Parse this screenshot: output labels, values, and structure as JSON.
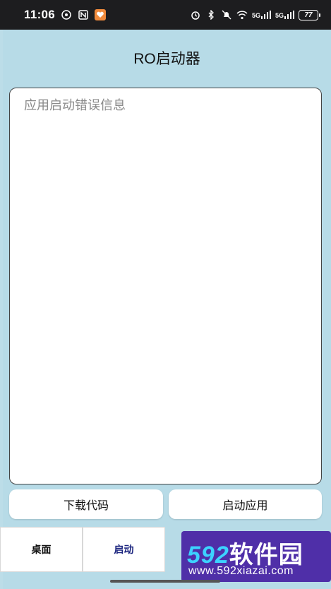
{
  "status_bar": {
    "time": "11:06",
    "signal_label_1": "5G",
    "signal_label_2": "5G",
    "battery": "77"
  },
  "app": {
    "title": "RO启动器",
    "error_box": {
      "placeholder": "应用启动错误信息"
    },
    "buttons": {
      "download": "下载代码",
      "launch": "启动应用"
    },
    "nav": {
      "items": [
        {
          "label": "桌面"
        },
        {
          "label": "启动"
        }
      ]
    }
  },
  "watermark": {
    "number": "592",
    "brand": "软件园",
    "url": "www.592xiazai.com"
  }
}
